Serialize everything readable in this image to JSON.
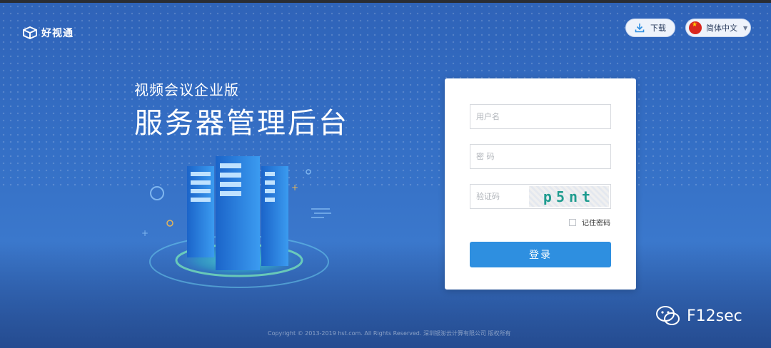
{
  "header": {
    "logo_text": "好视通",
    "download_label": "下载",
    "language_label": "简体中文"
  },
  "hero": {
    "subtitle": "视频会议企业版",
    "title": "服务器管理后台"
  },
  "login": {
    "username_placeholder": "用户名",
    "password_placeholder": "密 码",
    "captcha_placeholder": "验证码",
    "captcha_text": "p5nt",
    "remember_label": "记住密码",
    "submit_label": "登录"
  },
  "footer": {
    "copyright": "Copyright © 2013-2019 hst.com. All Rights Reserved. 深圳银澎云计算有限公司 版权所有"
  },
  "watermark": {
    "text": "F12sec"
  },
  "colors": {
    "accent": "#2e8fe0",
    "background": "#3570c6"
  }
}
